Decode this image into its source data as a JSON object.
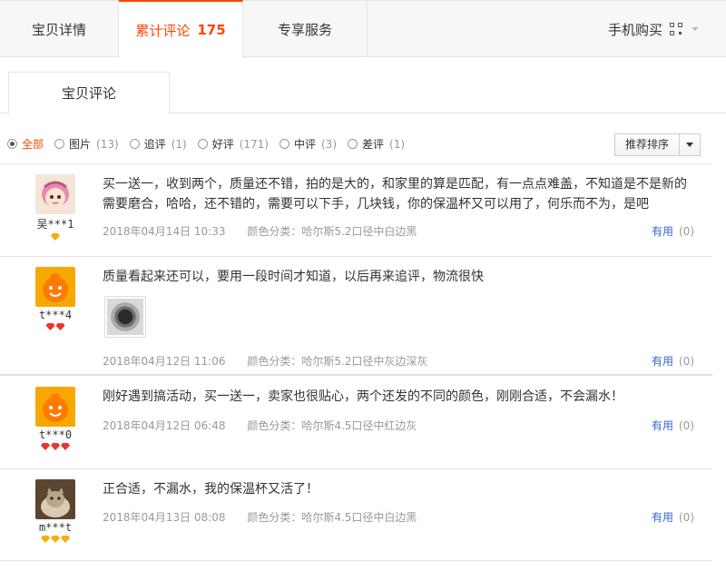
{
  "tabs": {
    "detail": "宝贝详情",
    "reviews": "累计评论",
    "reviews_count": "175",
    "service": "专享服务",
    "mobile_buy": "手机购买"
  },
  "subtab": {
    "label": "宝贝评论"
  },
  "filters": [
    {
      "label": "全部",
      "count": "",
      "selected": true
    },
    {
      "label": "图片",
      "count": "(13)",
      "selected": false
    },
    {
      "label": "追评",
      "count": "(1)",
      "selected": false
    },
    {
      "label": "好评",
      "count": "(171)",
      "selected": false
    },
    {
      "label": "中评",
      "count": "(3)",
      "selected": false
    },
    {
      "label": "差评",
      "count": "(1)",
      "selected": false
    }
  ],
  "sort": {
    "label": "推荐排序"
  },
  "reviews": [
    {
      "user": "吴***1",
      "badge_count": 1,
      "badge_color": "gold",
      "text": "买一送一，收到两个，质量还不错，拍的是大的，和家里的算是匹配，有一点点难盖，不知道是不是新的需要磨合，哈哈，还不错的，需要可以下手，几块钱，你的保温杯又可以用了，何乐而不为，是吧",
      "date": "2018年04月14日 10:33",
      "color": "颜色分类：哈尔斯5.2口径中白边黑",
      "useful_label": "有用",
      "useful_count": "(0)"
    },
    {
      "user": "t***4",
      "badge_count": 2,
      "badge_color": "red",
      "text": "质量看起来还可以，要用一段时间才知道，以后再来追评，物流很快",
      "date": "2018年04月12日 11:06",
      "color": "颜色分类：哈尔斯5.2口径中灰边深灰",
      "useful_label": "有用",
      "useful_count": "(0)"
    },
    {
      "user": "t***0",
      "badge_count": 3,
      "badge_color": "red",
      "text": "刚好遇到搞活动，买一送一，卖家也很贴心，两个还发的不同的颜色，刚刚合适，不会漏水！",
      "date": "2018年04月12日 06:48",
      "color": "颜色分类：哈尔斯4.5口径中红边灰",
      "useful_label": "有用",
      "useful_count": "(0)"
    },
    {
      "user": "m***t",
      "badge_count": 3,
      "badge_color": "gold",
      "text": "正合适，不漏水，我的保温杯又活了！",
      "date": "2018年04月13日 08:08",
      "color": "颜色分类：哈尔斯4.5口径中白边黑",
      "useful_label": "有用",
      "useful_count": "(0)"
    }
  ]
}
